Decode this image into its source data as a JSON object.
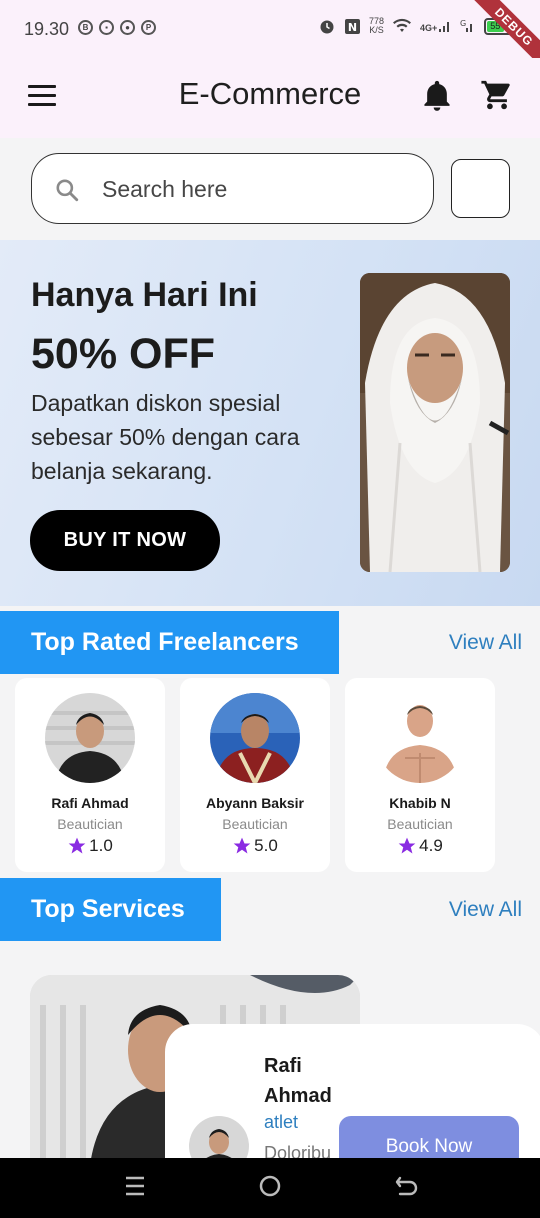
{
  "status_bar": {
    "time": "19.30",
    "network_speed": "778",
    "network_speed_unit": "K/S",
    "network_type": "4G+",
    "battery": "55",
    "debug_banner": "DEBUG"
  },
  "app_bar": {
    "title": "E-Commerce"
  },
  "search": {
    "placeholder": "Search here"
  },
  "banner": {
    "headline": "Hanya Hari Ini",
    "offer": "50% OFF",
    "description": "Dapatkan diskon spesial sebesar 50% dengan cara belanja sekarang.",
    "button_label": "BUY IT NOW"
  },
  "freelancers": {
    "title": "Top Rated Freelancers",
    "view_all": "View All",
    "items": [
      {
        "name": "Rafi Ahmad",
        "role": "Beautician",
        "rating": "1.0"
      },
      {
        "name": "Abyann Baksir",
        "role": "Beautician",
        "rating": "5.0"
      },
      {
        "name": "Khabib N",
        "role": "Beautician",
        "rating": "4.9"
      }
    ]
  },
  "services": {
    "title": "Top Services",
    "view_all": "View All",
    "card": {
      "name": "Rafi Ahmad",
      "type": "atlet",
      "description": "Doloribu",
      "button_label": "Book Now"
    }
  },
  "colors": {
    "accent": "#2196f3",
    "star": "#8a2be2",
    "book_button": "#7e8ee0",
    "app_bar_bg": "#fbf1fb"
  },
  "icons": {
    "menu": "hamburger-menu-icon",
    "notifications": "bell-icon",
    "cart": "shopping-cart-icon",
    "search": "search-icon",
    "star": "star-icon"
  }
}
